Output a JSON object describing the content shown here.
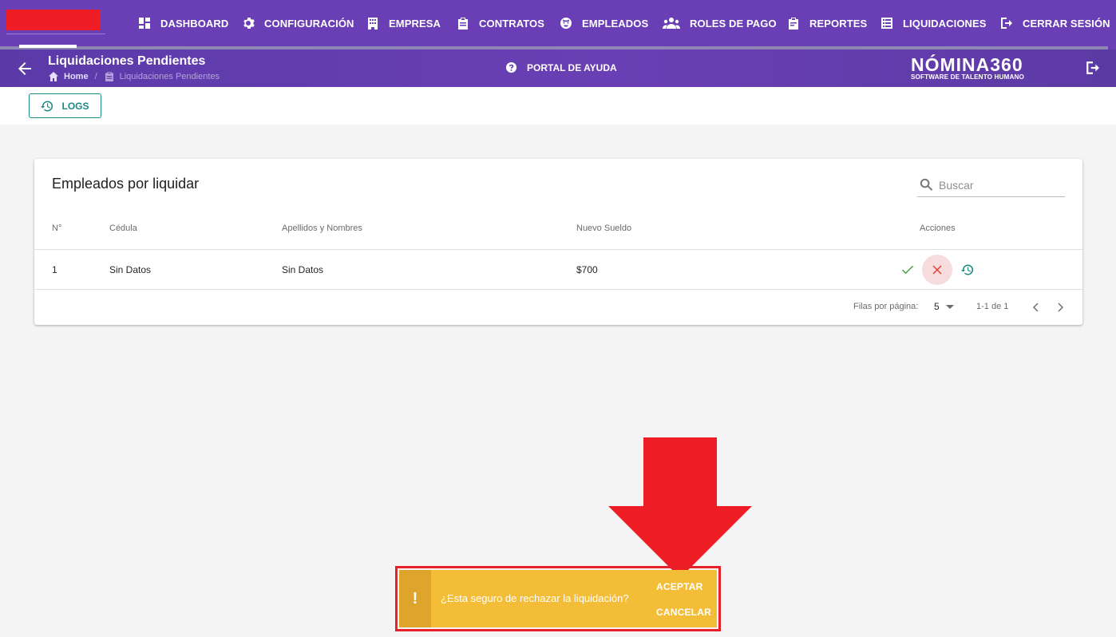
{
  "topnav": {
    "items": [
      {
        "label": "DASHBOARD",
        "icon": "dashboard-icon"
      },
      {
        "label": "CONFIGURACIÓN",
        "icon": "gear-icon"
      },
      {
        "label": "EMPRESA",
        "icon": "building-icon"
      },
      {
        "label": "CONTRATOS",
        "icon": "clipboard-icon"
      },
      {
        "label": "EMPLEADOS",
        "icon": "face-icon"
      },
      {
        "label": "ROLES DE PAGO",
        "icon": "users-icon"
      },
      {
        "label": "REPORTES",
        "icon": "report-icon"
      },
      {
        "label": "LIQUIDACIONES",
        "icon": "list-icon"
      },
      {
        "label": "CERRAR SESIÓN",
        "icon": "logout-icon"
      }
    ]
  },
  "subheader": {
    "title": "Liquidaciones Pendientes",
    "breadcrumb": {
      "home": "Home",
      "current": "Liquidaciones Pendientes"
    },
    "help_label": "PORTAL DE AYUDA",
    "logo_main": "NÓMINA360",
    "logo_sub": "SOFTWARE DE TALENTO HUMANO"
  },
  "toolbar": {
    "logs_label": "LOGS"
  },
  "table": {
    "title": "Empleados por liquidar",
    "search_placeholder": "Buscar",
    "columns": [
      "N°",
      "Cédula",
      "Apellidos y Nombres",
      "Nuevo Sueldo",
      "Acciones"
    ],
    "rows": [
      {
        "n": "1",
        "cedula": "Sin Datos",
        "nombres": "Sin Datos",
        "sueldo": "$700"
      }
    ]
  },
  "pagination": {
    "rows_per_page_label": "Filas por página:",
    "rows_per_page": "5",
    "range": "1-1 de 1"
  },
  "snackbar": {
    "icon": "!",
    "message": "¿Esta seguro de rechazar la liquidación?",
    "accept_label": "ACEPTAR",
    "cancel_label": "CANCELAR"
  },
  "colors": {
    "primary": "#6a3fb5",
    "teal": "#1c8a82",
    "warning": "#f3bd37",
    "annotation_red": "#e8202a"
  }
}
